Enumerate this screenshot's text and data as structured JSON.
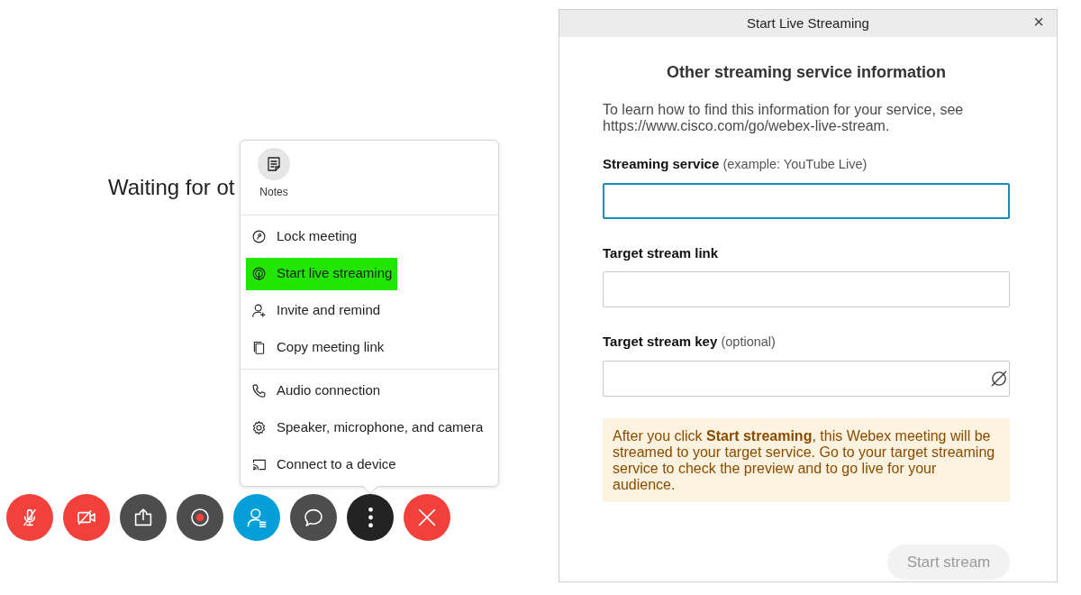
{
  "meeting": {
    "status_text": "Waiting for ot"
  },
  "menu": {
    "apps": [
      {
        "label": "Notes",
        "kind": "notes"
      }
    ],
    "sections": [
      {
        "items": [
          {
            "label": "Lock meeting",
            "kind": "lock",
            "highlighted": false
          },
          {
            "label": "Start live streaming",
            "kind": "stream",
            "highlighted": true
          },
          {
            "label": "Invite and remind",
            "kind": "invite",
            "highlighted": false
          },
          {
            "label": "Copy meeting link",
            "kind": "copy",
            "highlighted": false
          }
        ]
      },
      {
        "items": [
          {
            "label": "Audio connection",
            "kind": "phone",
            "highlighted": false
          },
          {
            "label": "Speaker, microphone, and camera",
            "kind": "gear",
            "highlighted": false
          },
          {
            "label": "Connect to a device",
            "kind": "cast",
            "highlighted": false
          }
        ]
      }
    ]
  },
  "toolbar": [
    {
      "kind": "mic-off",
      "color": "#f2413b"
    },
    {
      "kind": "video-off",
      "color": "#f2413b"
    },
    {
      "kind": "share",
      "color": "#4d4d4d"
    },
    {
      "kind": "record",
      "color": "#4d4d4d"
    },
    {
      "kind": "participants",
      "color": "#049fd9"
    },
    {
      "kind": "chat",
      "color": "#4d4d4d"
    },
    {
      "kind": "more",
      "color": "#232323"
    },
    {
      "kind": "end",
      "color": "#f2413b"
    }
  ],
  "dialog": {
    "title": "Start Live Streaming",
    "close": "×",
    "heading": "Other streaming service information",
    "intro": "To learn how to find this information for your service, see https://www.cisco.com/go/webex-live-stream.",
    "fields": [
      {
        "label": "Streaming service",
        "hint": "(example: YouTube Live)",
        "kind": "text",
        "focused": true
      },
      {
        "label": "Target stream link",
        "kind": "text",
        "focused": false
      },
      {
        "label": "Target stream key",
        "hint": "(optional)",
        "kind": "secret",
        "focused": false
      }
    ],
    "note": "After you click **Start streaming**, this Webex meeting will be streamed to your target service. Go to your target streaming service to check the preview and to go live for your audience.",
    "button": {
      "label": "Start stream",
      "disabled": true
    }
  }
}
